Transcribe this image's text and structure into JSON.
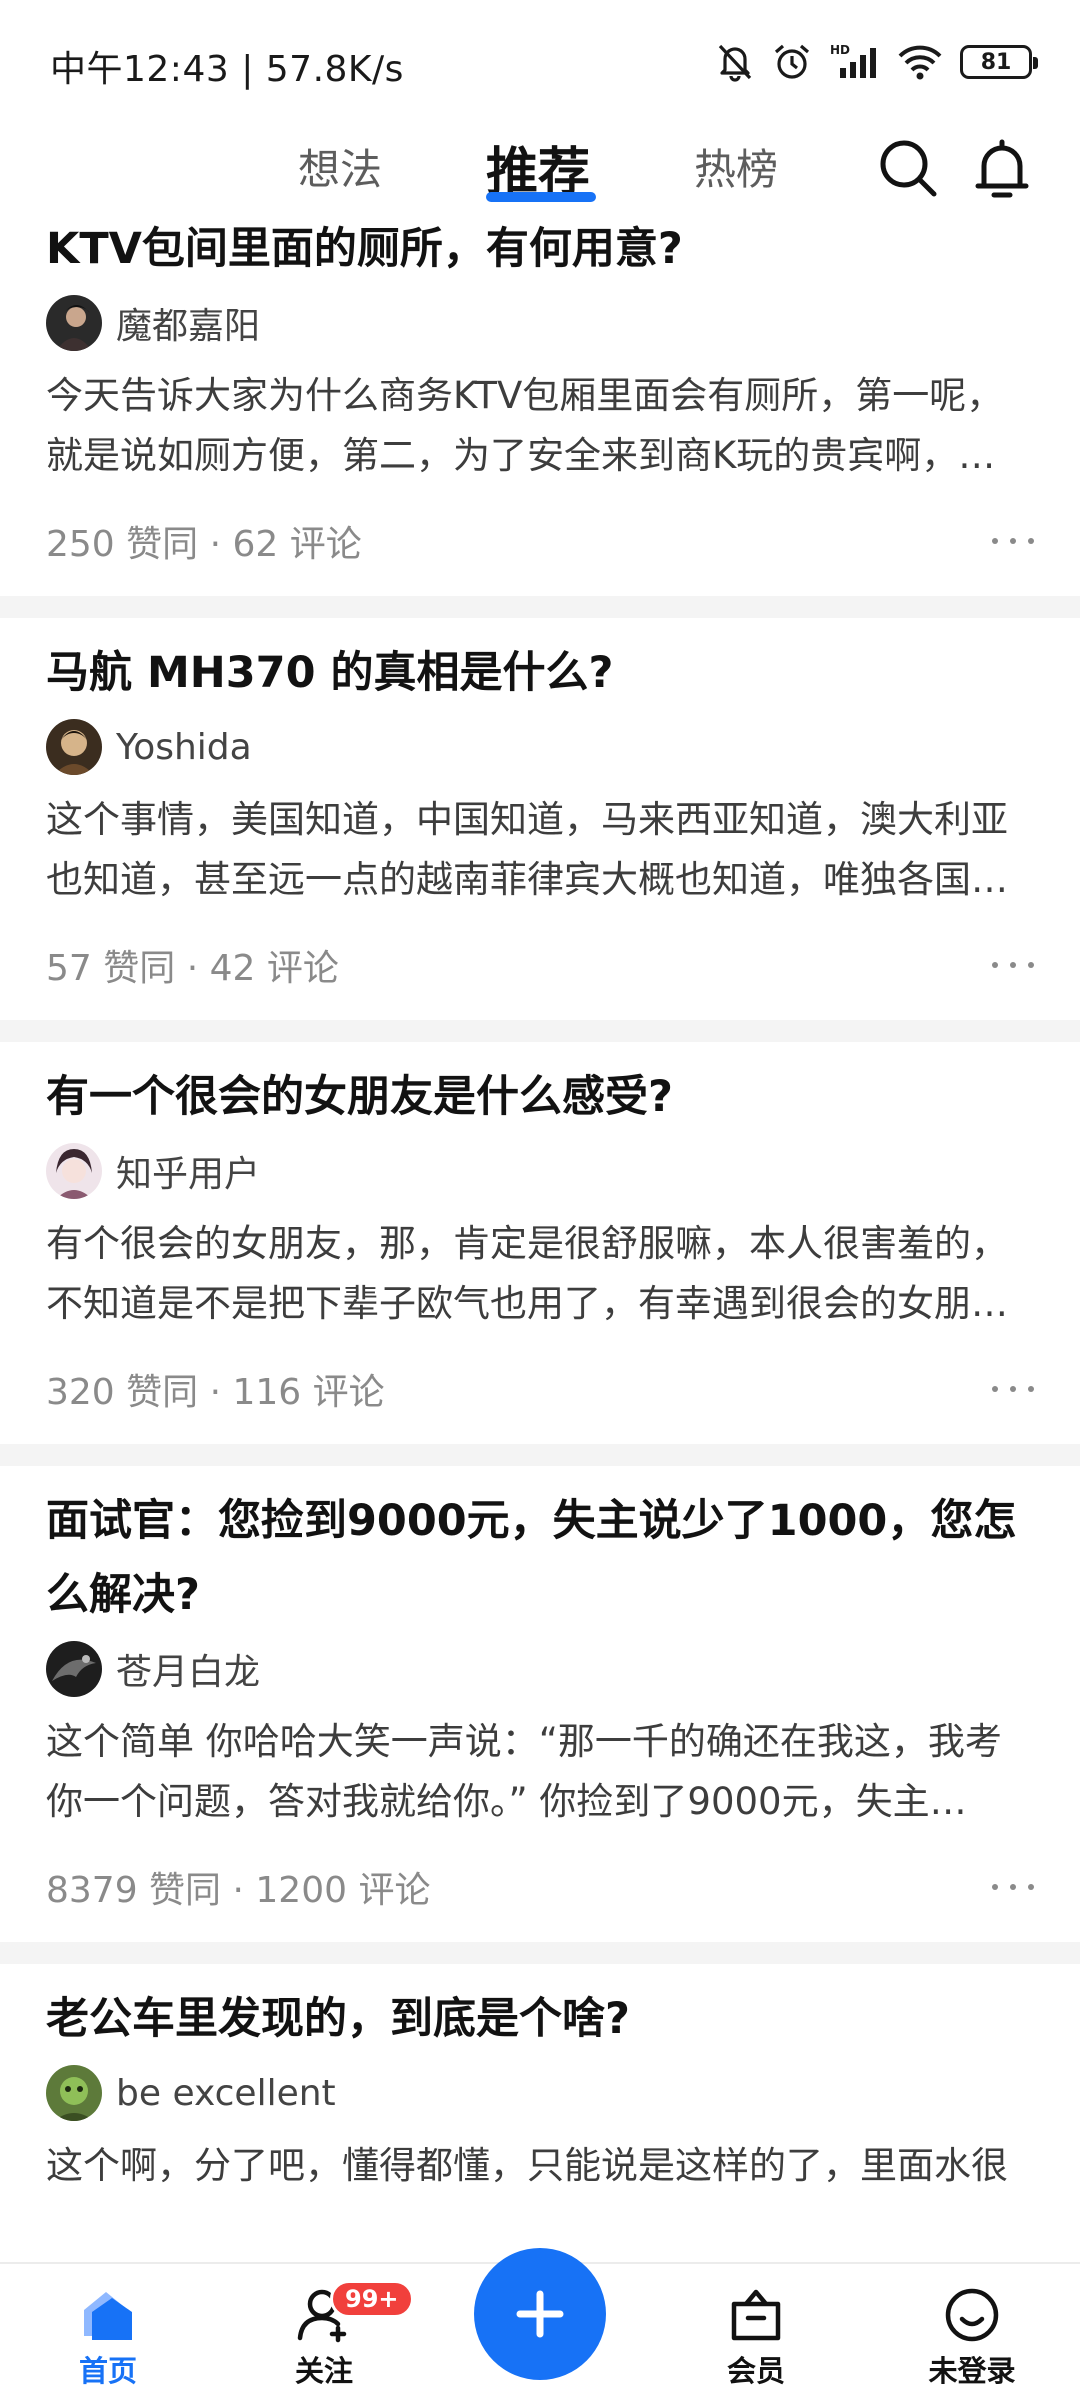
{
  "status_bar": {
    "time_speed": "中午12:43 | 57.8K/s",
    "battery": "81"
  },
  "top_nav": {
    "tabs": [
      {
        "label": "想法"
      },
      {
        "label": "推荐",
        "active": true
      },
      {
        "label": "热榜"
      }
    ],
    "icons": [
      "search-icon",
      "bell-icon"
    ],
    "accent_color": "#1772f6"
  },
  "feed": [
    {
      "title": "KTV包间里面的厕所，有何用意?",
      "author": "魔都嘉阳",
      "excerpt_line1": "今天告诉大家为什么商务KTV包厢里面会有厕所，第一呢，",
      "excerpt_line2": "就是说如厕方便，第二，为了安全来到商K玩的贵宾啊，…",
      "meta": "250 赞同 · 62 评论"
    },
    {
      "title": "马航 MH370 的真相是什么?",
      "author": "Yoshida",
      "excerpt_line1": "这个事情，美国知道，中国知道，马来西亚知道，澳大利亚",
      "excerpt_line2": "也知道，甚至远一点的越南菲律宾大概也知道，唯独各国…",
      "meta": "57 赞同 · 42 评论"
    },
    {
      "title": "有一个很会的女朋友是什么感受?",
      "author": "知乎用户",
      "excerpt_line1": "有个很会的女朋友，那，肯定是很舒服嘛，本人很害羞的，",
      "excerpt_line2": "不知道是不是把下辈子欧气也用了，有幸遇到很会的女朋…",
      "meta": "320 赞同 · 116 评论"
    },
    {
      "title_line1": "面试官：您捡到9000元，失主说少了1000，您怎",
      "title_line2": "么解决?",
      "author": "苍月白龙",
      "excerpt_line1": "这个简单 你哈哈大笑一声说：“那一千的确还在我这，我考",
      "excerpt_line2": "你一个问题，答对我就给你。” 你捡到了9000元，失主…",
      "meta": "8379 赞同 · 1200 评论"
    },
    {
      "title": "老公车里发现的，到底是个啥?",
      "author": "be excellent",
      "excerpt_line1": "这个啊，分了吧，懂得都懂，只能说是这样的了，里面水很"
    }
  ],
  "bottom_nav": {
    "items": [
      {
        "label": "首页",
        "icon": "home-icon",
        "active": true
      },
      {
        "label": "关注",
        "icon": "follow-icon",
        "badge": "99+"
      },
      {
        "label": "会员",
        "icon": "vip-bag-icon"
      },
      {
        "label": "未登录",
        "icon": "profile-icon"
      }
    ],
    "fab_icon": "plus-icon"
  }
}
